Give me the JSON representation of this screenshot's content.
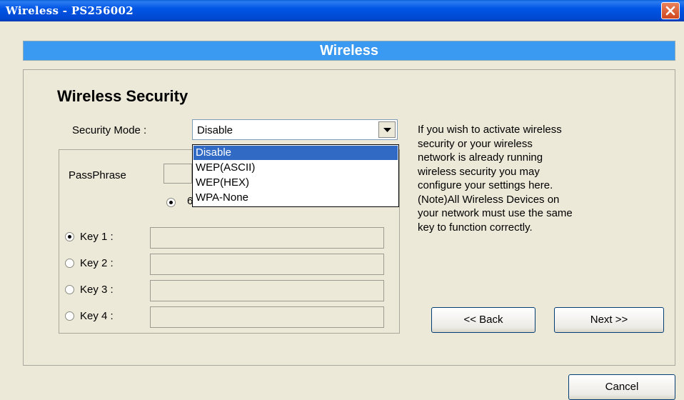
{
  "window": {
    "title": "Wireless - PS256002"
  },
  "banner": {
    "title": "Wireless"
  },
  "section": {
    "heading": "Wireless Security"
  },
  "security_mode": {
    "label": "Security Mode :",
    "selected": "Disable",
    "options": [
      "Disable",
      "WEP(ASCII)",
      "WEP(HEX)",
      "WPA-None"
    ]
  },
  "passphrase": {
    "label": "PassPhrase",
    "value": "",
    "radio_partial_text": "6"
  },
  "keys": [
    {
      "label": "Key 1 :",
      "checked": true,
      "value": ""
    },
    {
      "label": "Key 2 :",
      "checked": false,
      "value": ""
    },
    {
      "label": "Key 3 :",
      "checked": false,
      "value": ""
    },
    {
      "label": "Key 4 :",
      "checked": false,
      "value": ""
    }
  ],
  "help": {
    "lines": [
      "If you wish to activate wireless",
      "security or your wireless",
      "network is already running",
      "wireless security you may",
      "configure your settings here.",
      "(Note)All Wireless Devices on",
      "your network must use the same",
      "key to function correctly."
    ]
  },
  "buttons": {
    "back": "<< Back",
    "next": "Next >>",
    "cancel": "Cancel"
  },
  "colors": {
    "titlebar": "#0055e5",
    "banner": "#3a99f0",
    "selection": "#316ac5",
    "background": "#ece9d8"
  }
}
